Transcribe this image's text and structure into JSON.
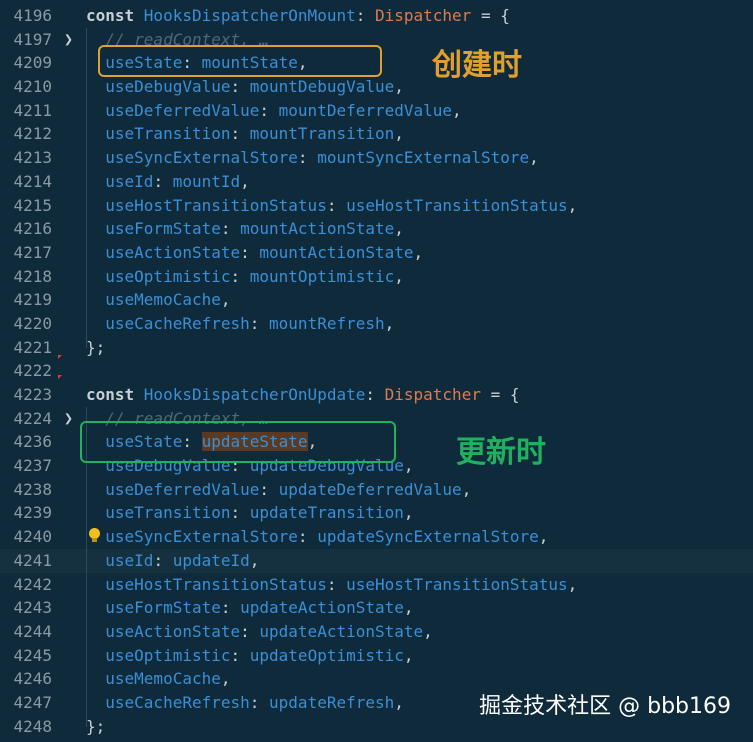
{
  "colors": {
    "background": "#0f2a3a",
    "identifier": "#3b8fd6",
    "type": "#e07a50",
    "mount_box": "#e0a030",
    "update_box": "#20b060"
  },
  "lines": [
    {
      "n": "4196",
      "t": [
        [
          "kw",
          "const "
        ],
        [
          "id",
          "HooksDispatcherOnMount"
        ],
        [
          "p",
          ": "
        ],
        [
          "ty",
          "Dispatcher"
        ],
        [
          "p",
          " = {"
        ]
      ]
    },
    {
      "n": "4197",
      "fold": true,
      "t": [
        [
          "cm",
          "  // readContext, …"
        ]
      ]
    },
    {
      "n": "4209",
      "t": [
        [
          "id",
          "  useState"
        ],
        [
          "p",
          ": "
        ],
        [
          "id",
          "mountState"
        ],
        [
          "p",
          ","
        ]
      ]
    },
    {
      "n": "4210",
      "t": [
        [
          "id",
          "  useDebugValue"
        ],
        [
          "p",
          ": "
        ],
        [
          "id",
          "mountDebugValue"
        ],
        [
          "p",
          ","
        ]
      ]
    },
    {
      "n": "4211",
      "t": [
        [
          "id",
          "  useDeferredValue"
        ],
        [
          "p",
          ": "
        ],
        [
          "id",
          "mountDeferredValue"
        ],
        [
          "p",
          ","
        ]
      ]
    },
    {
      "n": "4212",
      "t": [
        [
          "id",
          "  useTransition"
        ],
        [
          "p",
          ": "
        ],
        [
          "id",
          "mountTransition"
        ],
        [
          "p",
          ","
        ]
      ]
    },
    {
      "n": "4213",
      "t": [
        [
          "id",
          "  useSyncExternalStore"
        ],
        [
          "p",
          ": "
        ],
        [
          "id",
          "mountSyncExternalStore"
        ],
        [
          "p",
          ","
        ]
      ]
    },
    {
      "n": "4214",
      "t": [
        [
          "id",
          "  useId"
        ],
        [
          "p",
          ": "
        ],
        [
          "id",
          "mountId"
        ],
        [
          "p",
          ","
        ]
      ]
    },
    {
      "n": "4215",
      "t": [
        [
          "id",
          "  useHostTransitionStatus"
        ],
        [
          "p",
          ": "
        ],
        [
          "id",
          "useHostTransitionStatus"
        ],
        [
          "p",
          ","
        ]
      ]
    },
    {
      "n": "4216",
      "t": [
        [
          "id",
          "  useFormState"
        ],
        [
          "p",
          ": "
        ],
        [
          "id",
          "mountActionState"
        ],
        [
          "p",
          ","
        ]
      ]
    },
    {
      "n": "4217",
      "t": [
        [
          "id",
          "  useActionState"
        ],
        [
          "p",
          ": "
        ],
        [
          "id",
          "mountActionState"
        ],
        [
          "p",
          ","
        ]
      ]
    },
    {
      "n": "4218",
      "t": [
        [
          "id",
          "  useOptimistic"
        ],
        [
          "p",
          ": "
        ],
        [
          "id",
          "mountOptimistic"
        ],
        [
          "p",
          ","
        ]
      ]
    },
    {
      "n": "4219",
      "t": [
        [
          "id",
          "  useMemoCache"
        ],
        [
          "p",
          ","
        ]
      ]
    },
    {
      "n": "4220",
      "t": [
        [
          "id",
          "  useCacheRefresh"
        ],
        [
          "p",
          ": "
        ],
        [
          "id",
          "mountRefresh"
        ],
        [
          "p",
          ","
        ]
      ]
    },
    {
      "n": "4221",
      "t": [
        [
          "p",
          "};"
        ]
      ]
    },
    {
      "n": "4222",
      "t": []
    },
    {
      "n": "4223",
      "t": [
        [
          "kw",
          "const "
        ],
        [
          "id",
          "HooksDispatcherOnUpdate"
        ],
        [
          "p",
          ": "
        ],
        [
          "ty",
          "Dispatcher"
        ],
        [
          "p",
          " = {"
        ]
      ]
    },
    {
      "n": "4224",
      "fold": true,
      "t": [
        [
          "cm",
          "  // readContext, …"
        ]
      ]
    },
    {
      "n": "4236",
      "t": [
        [
          "id",
          "  useState"
        ],
        [
          "p",
          ": "
        ],
        [
          "id sel",
          "updateState"
        ],
        [
          "p",
          ","
        ]
      ]
    },
    {
      "n": "4237",
      "t": [
        [
          "id",
          "  useDebugValue"
        ],
        [
          "p",
          ": "
        ],
        [
          "id",
          "updateDebugValue"
        ],
        [
          "p",
          ","
        ]
      ]
    },
    {
      "n": "4238",
      "t": [
        [
          "id",
          "  useDeferredValue"
        ],
        [
          "p",
          ": "
        ],
        [
          "id",
          "updateDeferredValue"
        ],
        [
          "p",
          ","
        ]
      ]
    },
    {
      "n": "4239",
      "t": [
        [
          "id",
          "  useTransition"
        ],
        [
          "p",
          ": "
        ],
        [
          "id",
          "updateTransition"
        ],
        [
          "p",
          ","
        ]
      ]
    },
    {
      "n": "4240",
      "t": [
        [
          "id",
          "  useSyncExternalStore"
        ],
        [
          "p",
          ": "
        ],
        [
          "id",
          "updateSyncExternalStore"
        ],
        [
          "p",
          ","
        ]
      ]
    },
    {
      "n": "4241",
      "hl": true,
      "t": [
        [
          "id",
          "  useId"
        ],
        [
          "p",
          ": "
        ],
        [
          "id",
          "updateId"
        ],
        [
          "p",
          ","
        ]
      ]
    },
    {
      "n": "4242",
      "t": [
        [
          "id",
          "  useHostTransitionStatus"
        ],
        [
          "p",
          ": "
        ],
        [
          "id",
          "useHostTransitionStatus"
        ],
        [
          "p",
          ","
        ]
      ]
    },
    {
      "n": "4243",
      "t": [
        [
          "id",
          "  useFormState"
        ],
        [
          "p",
          ": "
        ],
        [
          "id",
          "updateActionState"
        ],
        [
          "p",
          ","
        ]
      ]
    },
    {
      "n": "4244",
      "t": [
        [
          "id",
          "  useActionState"
        ],
        [
          "p",
          ": "
        ],
        [
          "id",
          "updateActionState"
        ],
        [
          "p",
          ","
        ]
      ]
    },
    {
      "n": "4245",
      "t": [
        [
          "id",
          "  useOptimistic"
        ],
        [
          "p",
          ": "
        ],
        [
          "id",
          "updateOptimistic"
        ],
        [
          "p",
          ","
        ]
      ]
    },
    {
      "n": "4246",
      "t": [
        [
          "id",
          "  useMemoCache"
        ],
        [
          "p",
          ","
        ]
      ]
    },
    {
      "n": "4247",
      "t": [
        [
          "id",
          "  useCacheRefresh"
        ],
        [
          "p",
          ": "
        ],
        [
          "id",
          "updateRefresh"
        ],
        [
          "p",
          ","
        ]
      ]
    },
    {
      "n": "4248",
      "t": [
        [
          "p",
          "};"
        ]
      ]
    }
  ],
  "annotations": {
    "mount": "创建时",
    "update": "更新时"
  },
  "watermark": "掘金技术社区 @ bbb169",
  "icons": {
    "fold": "chevron-right-icon",
    "bulb": "lightbulb-icon"
  }
}
